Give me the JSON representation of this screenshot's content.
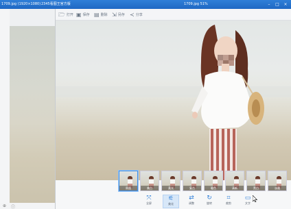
{
  "background_window": {
    "title_left": "1709.jpg (1920×1080)",
    "title_mid": "2345看图王官方版",
    "title_right": "1709.jpg 51%"
  },
  "toolbar": {
    "buttons": [
      {
        "label": "打开",
        "icon": "folder-icon"
      },
      {
        "label": "保存",
        "icon": "save-icon"
      },
      {
        "label": "删除",
        "icon": "trash-icon"
      },
      {
        "label": "另存",
        "icon": "export-icon"
      },
      {
        "label": "分享",
        "icon": "share-icon"
      }
    ]
  },
  "filmstrip": {
    "thumbs": [
      {
        "label": "原图",
        "selected": true
      },
      {
        "label": "美白",
        "selected": false
      },
      {
        "label": "柔光",
        "selected": false
      },
      {
        "label": "复古",
        "selected": false
      },
      {
        "label": "暖色",
        "selected": false
      },
      {
        "label": "清新",
        "selected": false
      },
      {
        "label": "黑白",
        "selected": false
      },
      {
        "label": "淡雅",
        "selected": false
      }
    ]
  },
  "tools": [
    {
      "label": "全屏",
      "icon": "fullscreen-icon",
      "active": false
    },
    {
      "label": "美化",
      "icon": "magic-wand-icon",
      "active": true
    },
    {
      "label": "调整",
      "icon": "adjust-icon",
      "active": false
    },
    {
      "label": "旋转",
      "icon": "rotate-icon",
      "active": false
    },
    {
      "label": "裁剪",
      "icon": "crop-icon",
      "active": false
    },
    {
      "label": "文字",
      "icon": "text-icon",
      "active": false
    }
  ],
  "colors": {
    "accent": "#2f7fd8",
    "titlebar": "#1f68c4"
  }
}
